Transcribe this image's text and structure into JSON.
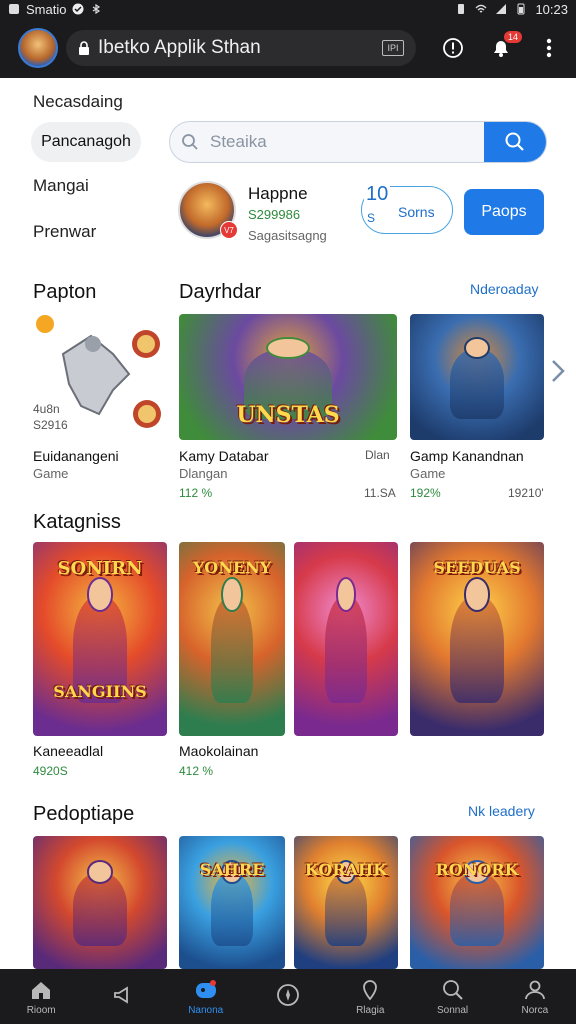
{
  "status_bar": {
    "carrier": "Smatio",
    "time": "10:23"
  },
  "app_bar": {
    "url": "Ibetko Applik Sthan",
    "tabs_label": "IPI",
    "notification_badge": "14"
  },
  "side_nav": {
    "item1": "Necasdaing",
    "chip": "Pancanagoh",
    "item2": "Mangai",
    "item3": "Prenwar"
  },
  "search": {
    "placeholder": "Steaika"
  },
  "featured": {
    "name": "Happne",
    "price": "S299986",
    "subtitle": "Sagasitsagng",
    "icon_badge": "V7",
    "ghost_button": {
      "number": "10",
      "sub": "S",
      "label": "Sorns"
    },
    "primary_button": "Paops"
  },
  "section1": {
    "left_title": "Papton",
    "right_title": "Dayrhdar",
    "link": "Nderoaday",
    "side_card": {
      "price": "4u8n",
      "value": "S2916",
      "title": "Euidanangeni",
      "subtitle": "Game"
    },
    "cards": [
      {
        "art_text": "UNSTAS",
        "title": "Kamy Databar",
        "subtitle": "Dlangan",
        "price": "112 %",
        "tag": "Dlan",
        "meta": "11.SA",
        "colors": [
          "#3f8c3a",
          "#6b4aa0",
          "#e8a33a"
        ]
      },
      {
        "art_text": "",
        "title": "Gamp Kanandnan",
        "subtitle": "Game",
        "price": "192%",
        "meta": "19210'",
        "colors": [
          "#1d3b6b",
          "#3a6db0",
          "#d88a3a"
        ]
      }
    ]
  },
  "section2": {
    "title": "Katagniss",
    "cards": [
      {
        "art_text": "SANGIINS",
        "top_text": "SONIRN",
        "title": "Kaneeadlal",
        "price": "4920S",
        "colors": [
          "#6b2d8f",
          "#e44b2a",
          "#f5b640"
        ]
      },
      {
        "art_text": "YONENY",
        "title": "Maokolainan",
        "price": "412 %",
        "colors": [
          "#2e7d4f",
          "#d7632b",
          "#f3c14b"
        ]
      },
      {
        "art_text": "",
        "title": "",
        "price": "",
        "colors": [
          "#7a2a8f",
          "#d63a4a",
          "#f08bd0"
        ]
      },
      {
        "art_text": "SEEDUAS",
        "title": "",
        "price": "",
        "colors": [
          "#3a2c6b",
          "#e2782f",
          "#ffd24a"
        ]
      }
    ]
  },
  "section3": {
    "title": "Pedoptiape",
    "link": "Nk leadery",
    "cards": [
      {
        "art_text": "",
        "colors": [
          "#5a2a7a",
          "#d3492e",
          "#f6c04a"
        ]
      },
      {
        "art_text": "SAHRE",
        "colors": [
          "#1d4f8f",
          "#3aa0e0",
          "#f2b53a"
        ]
      },
      {
        "art_text": "KORAHK",
        "colors": [
          "#1f3f80",
          "#e0802f",
          "#ffdd4a"
        ]
      },
      {
        "art_text": "RONORK",
        "colors": [
          "#2a5fa8",
          "#d9552b",
          "#f8c44a"
        ]
      }
    ]
  },
  "bottom_nav": [
    {
      "label": "Rioom",
      "icon": "home-icon"
    },
    {
      "label": "",
      "icon": "megaphone-icon"
    },
    {
      "label": "Nanona",
      "icon": "games-icon"
    },
    {
      "label": "",
      "icon": "compass-icon"
    },
    {
      "label": "Rlagia",
      "icon": "location-icon"
    },
    {
      "label": "Sonnal",
      "icon": "search-icon"
    },
    {
      "label": "Norca",
      "icon": "profile-icon"
    }
  ]
}
